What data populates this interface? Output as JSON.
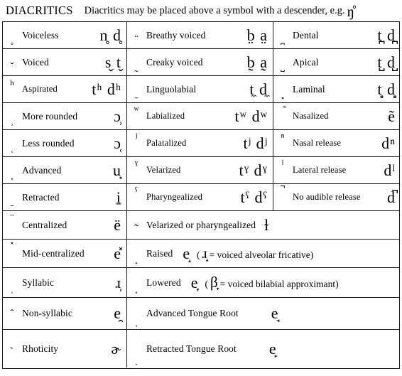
{
  "title": {
    "heading": "DIACRITICS",
    "note": "Diacritics may be placed above a symbol with a descender, e.g.",
    "example": "ŋ̊"
  },
  "columns": {
    "left_width": 175,
    "middle_width": 206,
    "right_width": 179
  },
  "rows": [
    {
      "left": {
        "mark": "̥",
        "label": "Voiceless",
        "examples": "n̥ d̥"
      },
      "middle": {
        "mark": "̈",
        "label": "Breathy voiced",
        "examples": "b̤ a̤"
      },
      "right": {
        "mark": "̪",
        "label": "Dental",
        "examples": "t̪ d̪"
      }
    },
    {
      "left": {
        "mark": "̌",
        "label": "Voiced",
        "examples": "s̬ t̬"
      },
      "middle": {
        "mark": "̰",
        "label": "Creaky voiced",
        "examples": "b̰ a̰"
      },
      "right": {
        "mark": "̺",
        "label": "Apical",
        "examples": "t̺ d̺"
      }
    },
    {
      "left": {
        "mark": "ʰ",
        "label": "Aspirated",
        "examples": "tʰ dʰ"
      },
      "middle": {
        "mark": "̼",
        "label": "Linguolabial",
        "examples": "t̼ d̼"
      },
      "right": {
        "mark": "̻",
        "label": "Laminal",
        "examples": "t̻ d̻"
      }
    },
    {
      "left": {
        "mark": "̹",
        "label": "More rounded",
        "examples": "ɔ̹"
      },
      "middle": {
        "mark": "ʷ",
        "label": "Labialized",
        "examples": "tʷ dʷ"
      },
      "right": {
        "mark": "̃",
        "label": "Nasalized",
        "examples": "ẽ"
      }
    },
    {
      "left": {
        "mark": "̜",
        "label": "Less rounded",
        "examples": "ɔ̜"
      },
      "middle": {
        "mark": "ʲ",
        "label": "Palatalized",
        "examples": "tʲ dʲ"
      },
      "right": {
        "mark": "ⁿ",
        "label": "Nasal release",
        "examples": "dⁿ"
      }
    },
    {
      "left": {
        "mark": "̟",
        "label": "Advanced",
        "examples": "u̟"
      },
      "middle": {
        "mark": "ˠ",
        "label": "Velarized",
        "examples": "tˠ dˠ"
      },
      "right": {
        "mark": "ˡ",
        "label": "Lateral release",
        "examples": "dˡ"
      }
    },
    {
      "left": {
        "mark": "̠",
        "label": "Retracted",
        "examples": "i̠"
      },
      "middle": {
        "mark": "ˤ",
        "label": "Pharyngealized",
        "examples": "tˤ dˤ"
      },
      "right": {
        "mark": "̚",
        "label": "No audible release",
        "examples": "d̚"
      }
    }
  ],
  "wide_rows": [
    {
      "left": {
        "mark": "̈",
        "label": "Centralized",
        "examples": "ë"
      },
      "wide": {
        "mark": "̴",
        "label": "Velarized or pharyngealized",
        "symbol": "ɫ"
      }
    },
    {
      "left": {
        "mark": "̽",
        "label": "Mid-centralized",
        "examples": "e̽"
      },
      "wide": {
        "mark": "̝",
        "label": "Raised",
        "examples": "e̝",
        "paren_open": "(",
        "paren_symbol": "ɹ̝",
        "paren_text": "= voiced alveolar fricative)"
      }
    },
    {
      "left": {
        "mark": "̩",
        "label": "Syllabic",
        "examples": "ɹ̩"
      },
      "wide": {
        "mark": "̞",
        "label": "Lowered",
        "examples": "e̞",
        "paren_open": "(",
        "paren_symbol": "β̞",
        "paren_text": "= voiced bilabial approximant)"
      }
    },
    {
      "left": {
        "mark": "̯",
        "label": "Non-syllabic",
        "examples": "e̯"
      },
      "wide": {
        "mark": "̘",
        "label": "Advanced Tongue Root",
        "symbol": "e̘"
      }
    },
    {
      "left": {
        "mark": "˞",
        "label": "Rhoticity",
        "examples": "ɚ"
      },
      "wide": {
        "mark": "̙",
        "label": "Retracted Tongue Root",
        "symbol": "e̙"
      }
    }
  ]
}
